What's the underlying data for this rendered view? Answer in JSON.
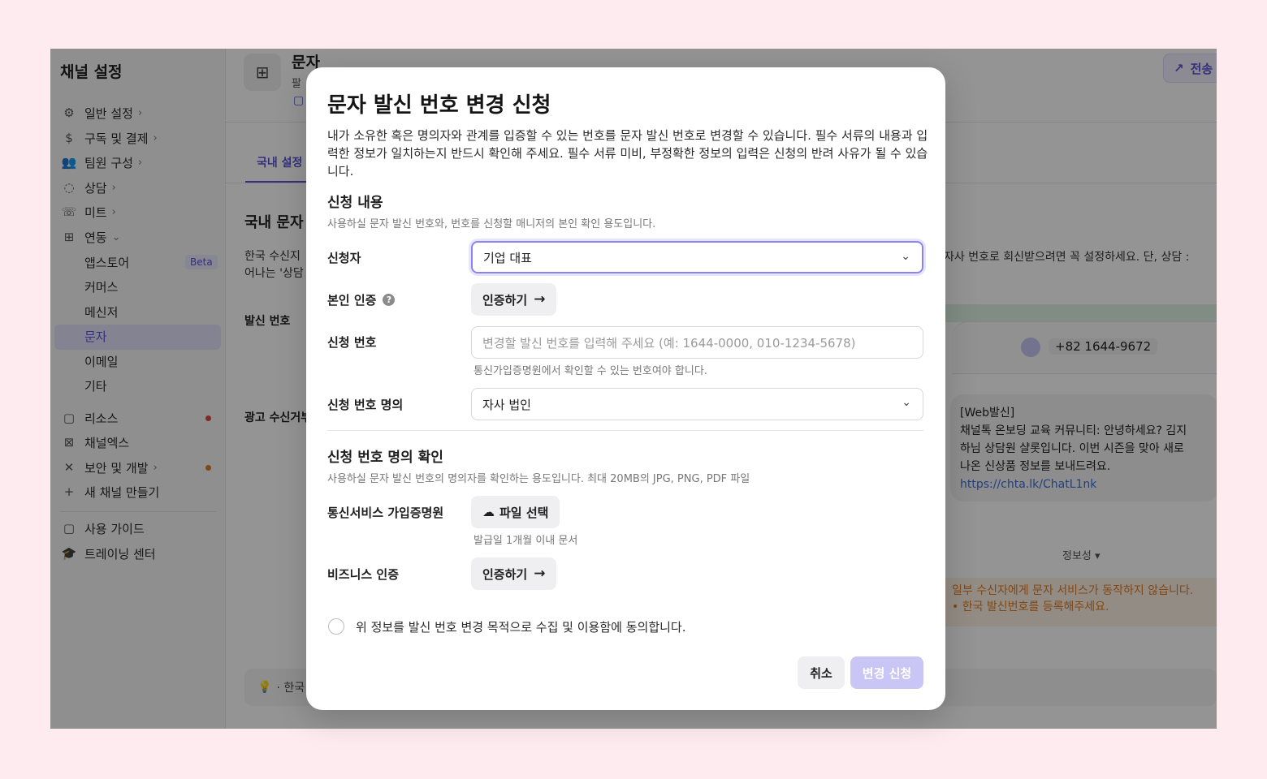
{
  "colors": {
    "accent": "#5a54d6",
    "page_bg": "#fdebef",
    "warning": "#e07a1f",
    "submit_disabled": "#c9c5f5"
  },
  "sidebar": {
    "title": "채널 설정",
    "items": [
      {
        "label": "일반 설정",
        "icon": "gear-icon"
      },
      {
        "label": "구독 및 결제",
        "icon": "dollar-circle-icon"
      },
      {
        "label": "팀원 구성",
        "icon": "people-icon"
      },
      {
        "label": "상담",
        "icon": "chat-bubble-icon"
      },
      {
        "label": "미트",
        "icon": "phone-icon"
      },
      {
        "label": "연동",
        "icon": "grid-icon"
      }
    ],
    "sub_items": [
      "앱스토어",
      "커머스",
      "메신저",
      "문자",
      "이메일",
      "기타"
    ],
    "beta_badge": "Beta",
    "items2": [
      {
        "label": "리소스",
        "icon": "book-icon"
      },
      {
        "label": "채널엑스",
        "icon": "channelx-icon"
      },
      {
        "label": "보안 및 개발",
        "icon": "tools-icon"
      },
      {
        "label": "새 채널 만들기",
        "icon": "plus-icon"
      }
    ],
    "items3": [
      {
        "label": "사용 가이드",
        "icon": "book-icon"
      },
      {
        "label": "트레이닝 센터",
        "icon": "graduation-cap-icon"
      }
    ]
  },
  "header": {
    "title": "문자",
    "subtitle": "팔",
    "send_button": "전송"
  },
  "tabs": {
    "domestic": "국내 설정"
  },
  "main": {
    "section_title": "국내 문자",
    "desc_line1": "한국 수신지",
    "desc_line2": "어나는 '상담",
    "desc_right": "자사 번호로 회신받으려면 꼭 설정하세요. 단, 상담 :",
    "sender_label": "발신 번호",
    "ad_label": "광고 수신거부",
    "phone_number": "+82 1644-9672",
    "message": {
      "line1": "[Web발신]",
      "line2": "채널톡 온보딩 교육 커뮤니티: 안녕하세요? 김지",
      "line3": "하님 상담원 샬롯입니다. 이번 시즌을 맞아 새로",
      "line4": "나온 신상품 정보를 보내드려요.",
      "link": "https://chta.lk/ChatL1nk"
    },
    "info_label": "정보성 ▾",
    "warning_line1": "일부 수신자에게 문자 서비스가 동작하지 않습니다.",
    "warning_line2": "• 한국 발신번호를 등록해주세요.",
    "tip": "· 한국"
  },
  "modal": {
    "title": "문자 발신 번호 변경 신청",
    "description": "내가 소유한 혹은 명의자와 관계를 입증할 수 있는 번호를 문자 발신 번호로 변경할 수 있습니다. 필수 서류의 내용과 입력한 정보가 일치하는지 반드시 확인해 주세요. 필수 서류 미비, 부정확한 정보의 입력은 신청의 반려 사유가 될 수 있습니다.",
    "section1_title": "신청 내용",
    "section1_desc": "사용하실 문자 발신 번호와, 번호를 신청할 매니저의 본인 확인 용도입니다.",
    "applicant_label": "신청자",
    "applicant_value": "기업 대표",
    "identity_label": "본인 인증",
    "identity_button": "인증하기",
    "number_label": "신청 번호",
    "number_placeholder": "변경할 발신 번호를 입력해 주세요 (예: 1644-0000, 010-1234-5678)",
    "number_hint": "통신가입증명원에서 확인할 수 있는 번호여야 합니다.",
    "owner_label": "신청 번호 명의",
    "owner_value": "자사 법인",
    "section2_title": "신청 번호 명의 확인",
    "section2_desc": "사용하실 문자 발신 번호의 명의자를 확인하는 용도입니다. 최대 20MB의 JPG, PNG, PDF 파일",
    "telecom_label": "통신서비스 가입증명원",
    "file_button": "파일 선택",
    "file_hint": "발급일 1개월 이내 문서",
    "business_label": "비즈니스 인증",
    "business_button": "인증하기",
    "consent_label": "위 정보를 발신 번호 변경 목적으로 수집 및 이용함에 동의합니다.",
    "cancel_button": "취소",
    "submit_button": "변경 신청"
  }
}
